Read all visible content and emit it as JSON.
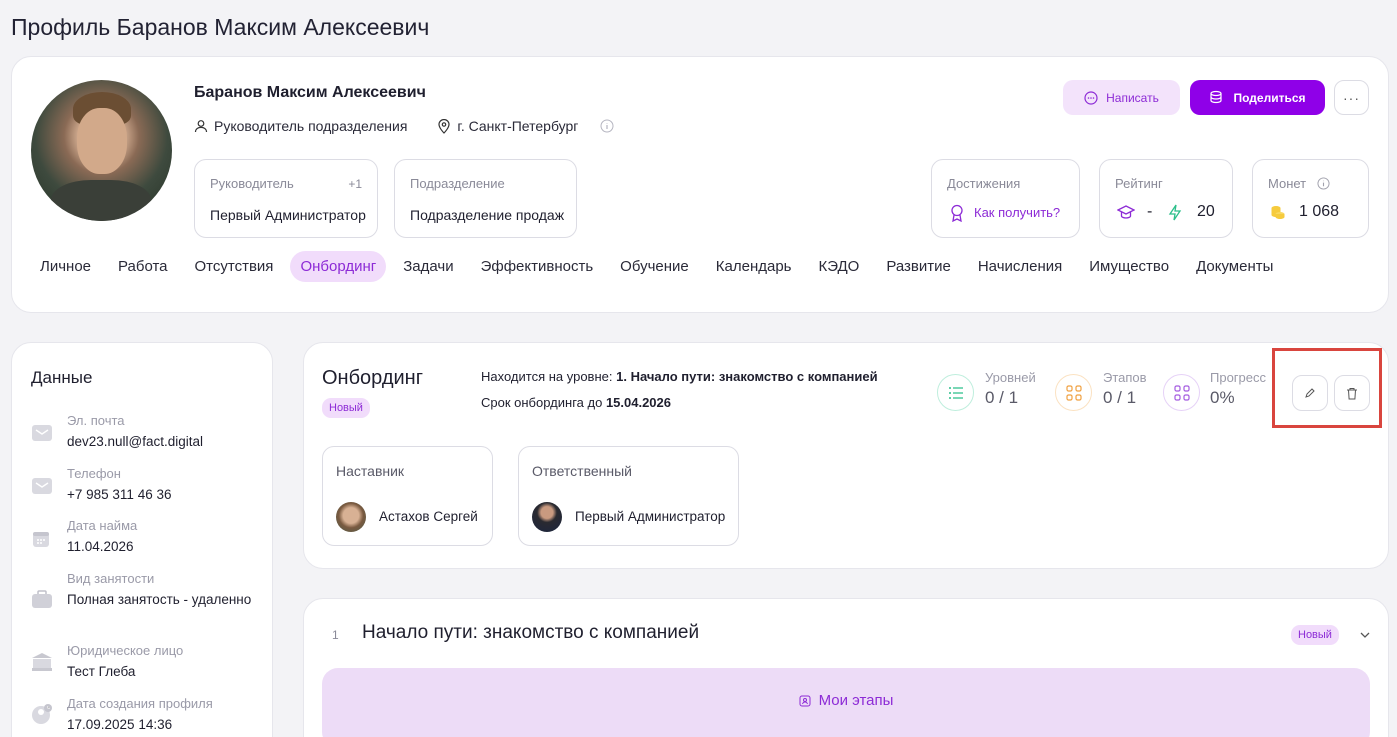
{
  "page": {
    "title": "Профиль Баранов Максим Алексеевич"
  },
  "profile": {
    "name": "Баранов Максим Алексеевич",
    "position": "Руководитель подразделения",
    "city": "г. Санкт-Петербург",
    "manager": {
      "label": "Руководитель",
      "extra": "+1",
      "value": "Первый Администратор"
    },
    "department": {
      "label": "Подразделение",
      "value": "Подразделение продаж"
    },
    "achievements": {
      "label": "Достижения",
      "link": "Как получить?"
    },
    "rating": {
      "label": "Рейтинг",
      "value1": "-",
      "value2": "20"
    },
    "coins": {
      "label": "Монет",
      "value": "1 068"
    },
    "actions": {
      "write": "Написать",
      "share": "Поделиться",
      "more": "···"
    }
  },
  "tabs": [
    "Личное",
    "Работа",
    "Отсутствия",
    "Онбординг",
    "Задачи",
    "Эффективность",
    "Обучение",
    "Календарь",
    "КЭДО",
    "Развитие",
    "Начисления",
    "Имущество",
    "Документы"
  ],
  "active_tab": "Онбординг",
  "data_panel": {
    "title": "Данные",
    "fields": [
      {
        "label": "Эл. почта",
        "value": "dev23.null@fact.digital",
        "icon": "mail-icon"
      },
      {
        "label": "Телефон",
        "value": "+7 985 311 46 36",
        "icon": "phone-icon"
      },
      {
        "label": "Дата найма",
        "value": "11.04.2026",
        "icon": "calendar-icon"
      },
      {
        "label": "Вид занятости",
        "value": "Полная занятость - удаленно",
        "icon": "briefcase-icon"
      },
      {
        "label": "Юридическое лицо",
        "value": "Тест Глеба",
        "icon": "bank-icon"
      },
      {
        "label": "Дата создания профиля",
        "value": "17.09.2025 14:36",
        "icon": "user-clock-icon"
      }
    ]
  },
  "onboarding": {
    "title": "Онбординг",
    "status": "Новый",
    "level_prefix": "Находится на уровне:",
    "level_value": "1. Начало пути: знакомство с компанией",
    "deadline_prefix": "Срок онбординга до",
    "deadline_value": "15.04.2026",
    "stats": [
      {
        "label": "Уровней",
        "value": "0 / 1",
        "color": "#2bbf8a"
      },
      {
        "label": "Этапов",
        "value": "0 / 1",
        "color": "#f0a040"
      },
      {
        "label": "Прогресс",
        "value": "0%",
        "color": "#a45be0"
      }
    ],
    "mentor": {
      "label": "Наставник",
      "name": "Астахов Сергей"
    },
    "responsible": {
      "label": "Ответственный",
      "name": "Первый Администратор"
    }
  },
  "level": {
    "number": "1",
    "title": "Начало пути: знакомство с компанией",
    "status": "Новый",
    "stages_label": "Мои этапы"
  },
  "colors": {
    "accent": "#8f00e8",
    "accent_soft": "#f1dcfb",
    "highlight": "#d9453e"
  }
}
